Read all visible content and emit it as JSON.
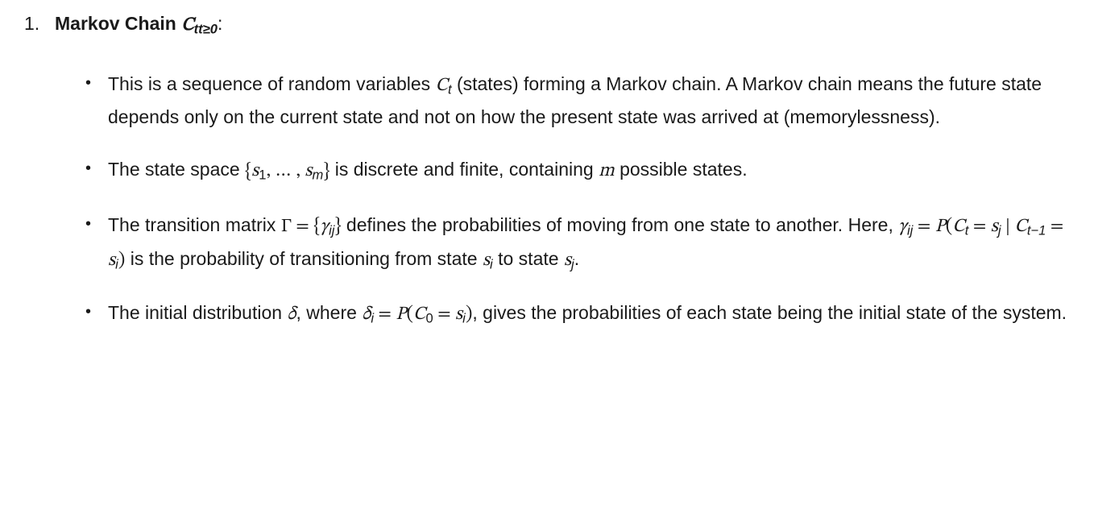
{
  "item": {
    "number": "1",
    "heading_strong": "Markov Chain",
    "heading_math": "C",
    "heading_sub": "tt≥0",
    "colon": ":"
  },
  "bullets": [
    {
      "pre1": "This is a sequence of random variables ",
      "math1": "C",
      "sub1": "t",
      "post1": " (states) forming a Markov chain. A Markov chain means the future state depends only on the current state and not on how the present state was arrived at (memorylessness)."
    },
    {
      "pre1": "The state space ",
      "lbrace": "{",
      "s1": "s",
      "s1sub": "1",
      "dots": ", … , ",
      "sm": "s",
      "smsub": "m",
      "rbrace": "}",
      "post1": " is discrete and finite, containing ",
      "m": "m",
      "post2": " possible states."
    },
    {
      "pre1": "The transition matrix ",
      "Gamma": "Γ",
      "eq1": " = ",
      "lbrace": "{",
      "gammaij": "γ",
      "gammaij_sub": "ij",
      "rbrace": "}",
      "mid1": " defines the probabilities of moving from one state to another. Here, ",
      "gammaij2": "γ",
      "gammaij2_sub": "ij",
      "eq2": " = ",
      "P": "P",
      "lparen": "(",
      "Ct": "C",
      "Ct_sub": "t",
      "eq3": " = ",
      "sj": "s",
      "sj_sub": "j",
      "mid": " | ",
      "Ctm1": "C",
      "Ctm1_sub": "t−1",
      "eq4": " = ",
      "si": "s",
      "si_sub": "i",
      "rparen": ")",
      "mid2": " is the probability of transitioning from state ",
      "si2": "s",
      "si2_sub": "i",
      "mid3": " to state ",
      "sj2": "s",
      "sj2_sub": "j",
      "period": "."
    },
    {
      "pre1": "The initial distribution ",
      "delta": "δ",
      "mid1": ", where ",
      "deltai": "δ",
      "deltai_sub": "i",
      "eq1": " = ",
      "P": "P",
      "lparen": "(",
      "C0": "C",
      "C0_sub": "0",
      "eq2": " = ",
      "si": "s",
      "si_sub": "i",
      "rparen": ")",
      "post1": ", gives the probabilities of each state being the initial state of the system."
    }
  ]
}
